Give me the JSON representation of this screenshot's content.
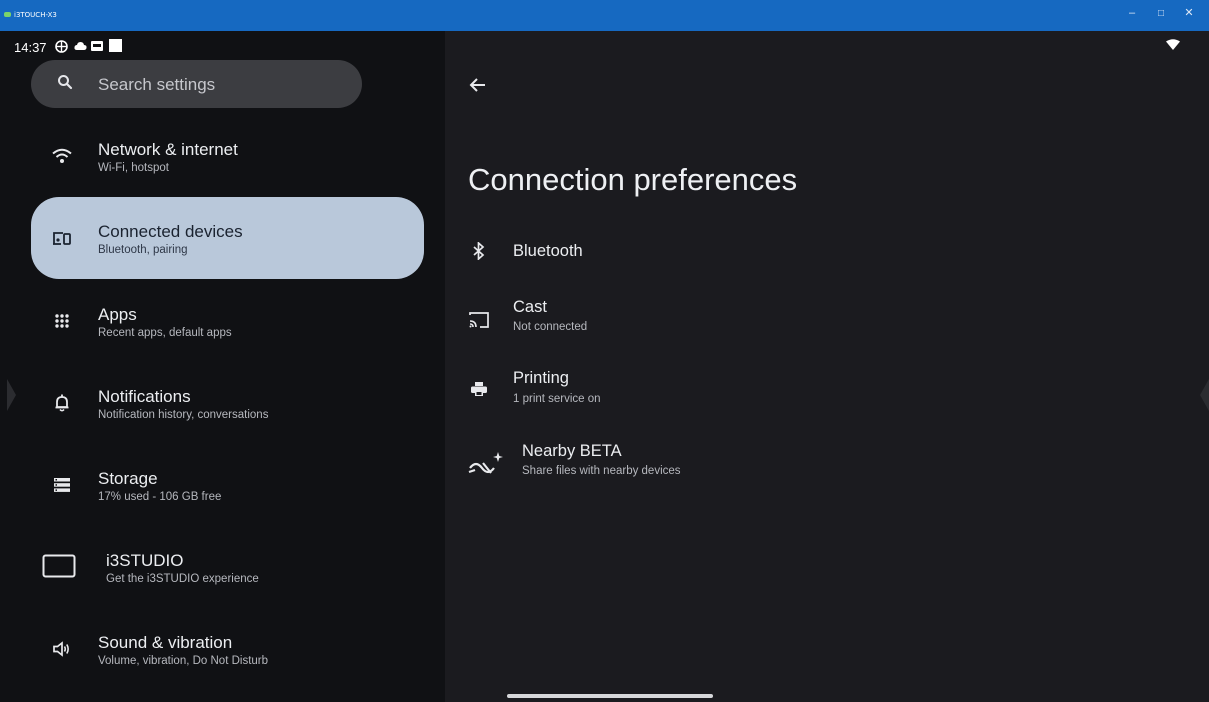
{
  "window": {
    "title": "i3TOUCH-X3",
    "controls": [
      "–",
      "□",
      "✕"
    ]
  },
  "status_bar": {
    "time": "14:37"
  },
  "search": {
    "placeholder": "Search settings"
  },
  "sidebar": {
    "items": [
      {
        "title": "Network & internet",
        "subtitle": "Wi-Fi, hotspot",
        "icon": "wifi-icon"
      },
      {
        "title": "Connected devices",
        "subtitle": "Bluetooth, pairing",
        "icon": "devices-icon",
        "active": true
      },
      {
        "title": "Apps",
        "subtitle": "Recent apps, default apps",
        "icon": "apps-grid-icon"
      },
      {
        "title": "Notifications",
        "subtitle": "Notification history, conversations",
        "icon": "bell-icon"
      },
      {
        "title": "Storage",
        "subtitle": "17% used - 106 GB free",
        "icon": "storage-icon"
      },
      {
        "title": "i3STUDIO",
        "subtitle": "Get the i3STUDIO experience",
        "icon": "tablet-icon"
      },
      {
        "title": "Sound & vibration",
        "subtitle": "Volume, vibration, Do Not Disturb",
        "icon": "speaker-icon"
      }
    ]
  },
  "main": {
    "title": "Connection preferences",
    "items": [
      {
        "title": "Bluetooth",
        "subtitle": "",
        "icon": "bluetooth-icon"
      },
      {
        "title": "Cast",
        "subtitle": "Not connected",
        "icon": "cast-icon"
      },
      {
        "title": "Printing",
        "subtitle": "1 print service on",
        "icon": "printer-icon"
      },
      {
        "title": "Nearby BETA",
        "subtitle": "Share files with nearby devices",
        "icon": "nearby-share-icon"
      }
    ]
  },
  "colors": {
    "titlebar": "#1669c1",
    "active_item": "#b9c8da",
    "sidebar_bg": "#101114",
    "main_bg": "#1b1b1f"
  }
}
